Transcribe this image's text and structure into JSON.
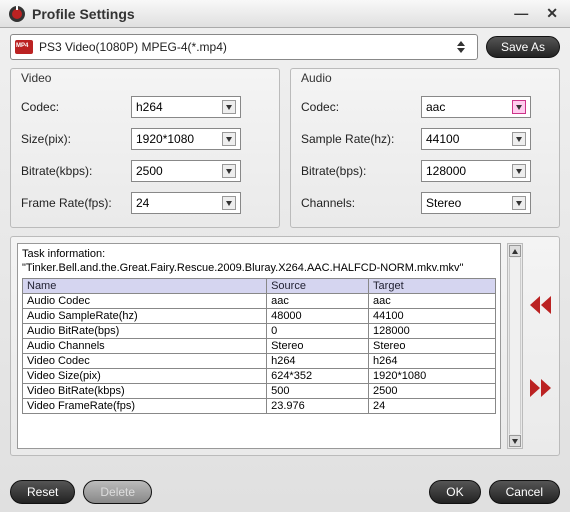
{
  "window": {
    "title": "Profile Settings"
  },
  "profile": {
    "selected": "PS3 Video(1080P) MPEG-4(*.mp4)",
    "save_as": "Save As"
  },
  "video": {
    "title": "Video",
    "codec_label": "Codec:",
    "codec_value": "h264",
    "size_label": "Size(pix):",
    "size_value": "1920*1080",
    "bitrate_label": "Bitrate(kbps):",
    "bitrate_value": "2500",
    "framerate_label": "Frame Rate(fps):",
    "framerate_value": "24"
  },
  "audio": {
    "title": "Audio",
    "codec_label": "Codec:",
    "codec_value": "aac",
    "samplerate_label": "Sample Rate(hz):",
    "samplerate_value": "44100",
    "bitrate_label": "Bitrate(bps):",
    "bitrate_value": "128000",
    "channels_label": "Channels:",
    "channels_value": "Stereo"
  },
  "task": {
    "label": "Task information:",
    "file": "\"Tinker.Bell.and.the.Great.Fairy.Rescue.2009.Bluray.X264.AAC.HALFCD-NORM.mkv.mkv\"",
    "headers": {
      "name": "Name",
      "source": "Source",
      "target": "Target"
    },
    "rows": [
      {
        "name": "Audio Codec",
        "source": "aac",
        "target": "aac"
      },
      {
        "name": "Audio SampleRate(hz)",
        "source": "48000",
        "target": "44100"
      },
      {
        "name": "Audio BitRate(bps)",
        "source": "0",
        "target": "128000"
      },
      {
        "name": "Audio Channels",
        "source": "Stereo",
        "target": "Stereo"
      },
      {
        "name": "Video Codec",
        "source": "h264",
        "target": "h264"
      },
      {
        "name": "Video Size(pix)",
        "source": "624*352",
        "target": "1920*1080"
      },
      {
        "name": "Video BitRate(kbps)",
        "source": "500",
        "target": "2500"
      },
      {
        "name": "Video FrameRate(fps)",
        "source": "23.976",
        "target": "24"
      }
    ]
  },
  "footer": {
    "reset": "Reset",
    "delete": "Delete",
    "ok": "OK",
    "cancel": "Cancel"
  }
}
